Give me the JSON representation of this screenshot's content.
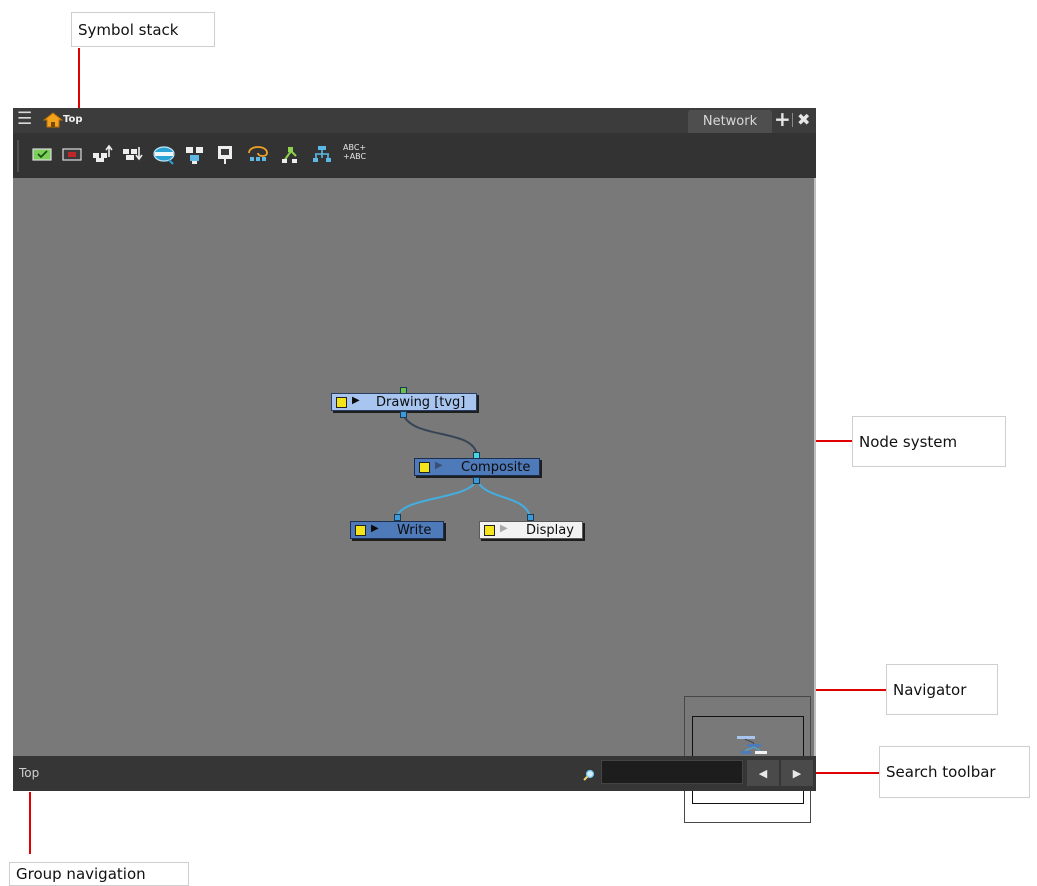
{
  "callouts": {
    "symbol_stack": "Symbol stack",
    "node_system": "Node system",
    "navigator": "Navigator",
    "search_toolbar": "Search toolbar",
    "group_navigation": "Group navigation"
  },
  "window": {
    "breadcrumb": "Top",
    "tab": "Network",
    "tab_add": "+",
    "tab_close": "✖"
  },
  "toolbar": {
    "buttons": [
      "enable-icon",
      "disable-icon",
      "move-up-icon",
      "move-down-icon",
      "view-icon",
      "group-icon",
      "display-icon",
      "peg-icon",
      "layer-icon",
      "composite-icon",
      "rename-icon"
    ],
    "abc_label_1": "ABC+",
    "abc_label_2": "+ABC"
  },
  "nodes": {
    "drawing": {
      "label": "Drawing  [tvg]",
      "arrow": "▶"
    },
    "composite": {
      "label": "Composite",
      "arrow": "▶"
    },
    "write": {
      "label": "Write",
      "arrow": "▶"
    },
    "display": {
      "label": "Display",
      "arrow": "▶"
    }
  },
  "bottombar": {
    "group_path": "Top",
    "search_value": "",
    "prev": "◀",
    "next": "▶"
  },
  "colors": {
    "node_blue": "#4f7ab9",
    "node_light": "#a7c5ef",
    "node_white": "#f2f2f2",
    "port_green": "#6bc04a",
    "port_cyan": "#46d6e6",
    "port_blue": "#3c9ad9",
    "callout_line": "#e00000"
  }
}
